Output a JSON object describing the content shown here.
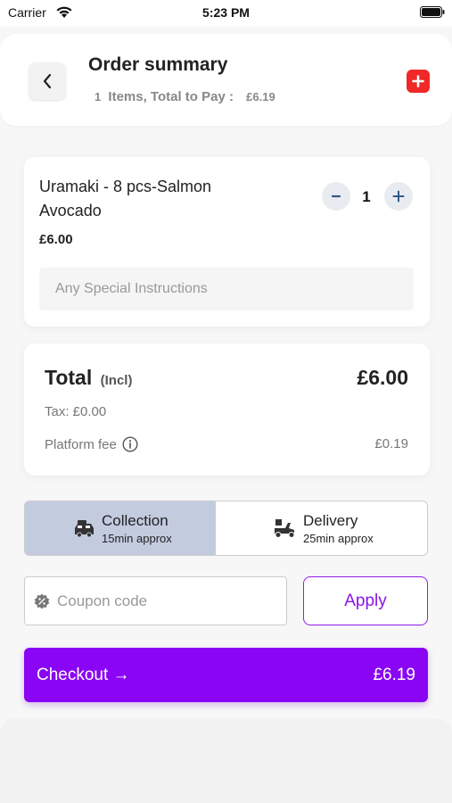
{
  "status_bar": {
    "carrier": "Carrier",
    "time": "5:23 PM"
  },
  "header": {
    "title": "Order summary",
    "item_count": "1",
    "subtitle_text": "Items, Total to Pay :",
    "total_to_pay": "£6.19"
  },
  "cart_item": {
    "name": "Uramaki - 8 pcs-Salmon Avocado",
    "price": "£6.00",
    "quantity": "1",
    "minus_symbol": "−",
    "plus_symbol": "+",
    "instructions_placeholder": "Any Special Instructions"
  },
  "totals": {
    "total_label": "Total",
    "incl_label": "(Incl)",
    "total_amount": "£6.00",
    "tax_text": "Tax: £0.00",
    "platform_fee_label": "Platform fee",
    "platform_fee_amount": "£0.19"
  },
  "fulfilment": {
    "collection": {
      "title": "Collection",
      "time": "15min approx",
      "selected": true
    },
    "delivery": {
      "title": "Delivery",
      "time": "25min approx",
      "selected": false
    }
  },
  "coupon": {
    "placeholder": "Coupon code",
    "apply_label": "Apply"
  },
  "checkout": {
    "label": "Checkout →",
    "amount": "£6.19"
  },
  "colors": {
    "accent_purple": "#8a05f3",
    "add_button_red": "#f02828",
    "selected_mode_bg": "#c3cbdf"
  },
  "icons": {
    "back": "chevron-left-icon",
    "add": "plus-icon",
    "info": "info-icon",
    "collection": "car-icon",
    "delivery": "scooter-icon",
    "coupon": "discount-badge-icon"
  }
}
